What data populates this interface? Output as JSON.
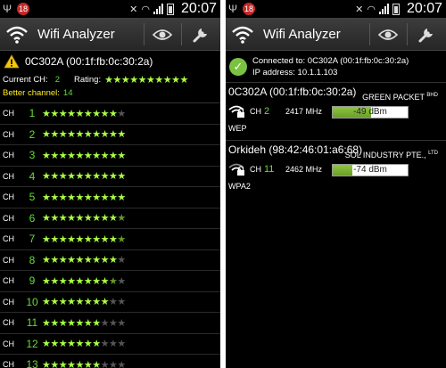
{
  "status_bar": {
    "notification_count": "18",
    "time": "20:07"
  },
  "app": {
    "title": "Wifi Analyzer"
  },
  "left": {
    "ap_name": "0C302A (00:1f:fb:0c:30:2a)",
    "current_ch_label": "Current CH:",
    "current_ch_value": "2",
    "rating_label": "Rating:",
    "rating_stars": 10,
    "better_channel_label": "Better channel:",
    "better_channel_value": "14",
    "ch_label": "CH",
    "channels": [
      {
        "num": "1",
        "rating": 9
      },
      {
        "num": "2",
        "rating": 10
      },
      {
        "num": "3",
        "rating": 10
      },
      {
        "num": "4",
        "rating": 10
      },
      {
        "num": "5",
        "rating": 10
      },
      {
        "num": "6",
        "rating": 9.5
      },
      {
        "num": "7",
        "rating": 9.5
      },
      {
        "num": "8",
        "rating": 9
      },
      {
        "num": "9",
        "rating": 8.5
      },
      {
        "num": "10",
        "rating": 8
      },
      {
        "num": "11",
        "rating": 7
      },
      {
        "num": "12",
        "rating": 7
      },
      {
        "num": "13",
        "rating": 7
      }
    ]
  },
  "right": {
    "connected_label": "Connected to:",
    "connected_value": "0C302A (00:1f:fb:0c:30:2a)",
    "ip_label": "IP address:",
    "ip_value": "10.1.1.103",
    "networks": [
      {
        "title": "0C302A (00:1f:fb:0c:30:2a)",
        "ch_label": "CH",
        "ch": "2",
        "freq": "2417 MHz",
        "vendor": "GREEN PACKET",
        "vendor_suffix": "BHD",
        "signal": "-49 dBm",
        "signal_level": 0.51,
        "security": "WEP"
      },
      {
        "title": "Orkideh (98:42:46:01:a6:68)",
        "ch_label": "CH",
        "ch": "11",
        "freq": "2462 MHz",
        "vendor": "SOL INDUSTRY PTE.,",
        "vendor_suffix": "LTD",
        "signal": "-74 dBm",
        "signal_level": 0.26,
        "security": "WPA2"
      }
    ]
  },
  "colors": {
    "accent_green": "#66dd33",
    "star_green": "#aaff44",
    "better_yellow": "#ffee22",
    "meter_green": "#8dc63f"
  },
  "icons": [
    "usb-icon",
    "notification-badge",
    "mute-icon",
    "wifi-icon",
    "signal-icon",
    "battery-icon",
    "wifi-app-icon",
    "eye-icon",
    "wrench-icon",
    "warning-icon",
    "check-icon",
    "lock-wifi-icon"
  ]
}
